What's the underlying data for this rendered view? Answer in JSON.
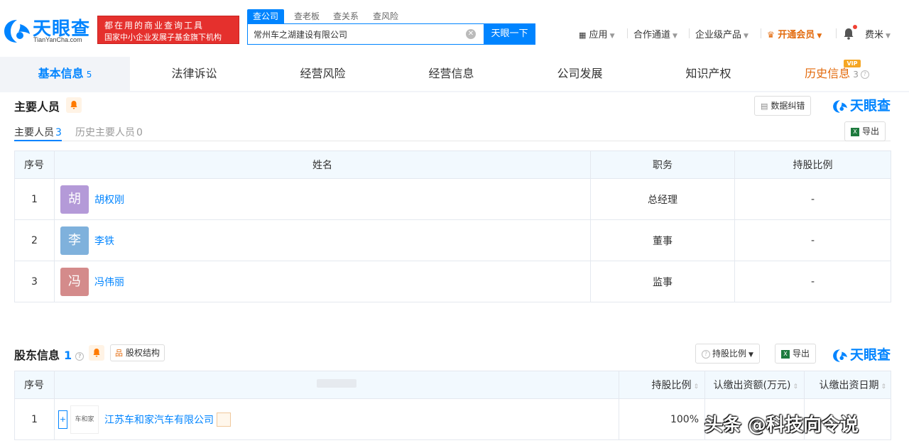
{
  "header": {
    "logo_cn": "天眼查",
    "logo_en": "TianYanCha.com",
    "slogan_line1": "都在用的商业查询工具",
    "slogan_line2": "国家中小企业发展子基金旗下机构",
    "search_tabs": [
      "查公司",
      "查老板",
      "查关系",
      "查风险"
    ],
    "search_value": "常州车之湖建设有限公司",
    "search_button": "天眼一下",
    "nav": {
      "apps": "应用",
      "partner": "合作通道",
      "enterprise": "企业级产品",
      "vip": "开通会员",
      "user": "费米"
    }
  },
  "category_tabs": [
    {
      "label": "基本信息",
      "count": "5"
    },
    {
      "label": "法律诉讼",
      "count": ""
    },
    {
      "label": "经营风险",
      "count": ""
    },
    {
      "label": "经营信息",
      "count": ""
    },
    {
      "label": "公司发展",
      "count": ""
    },
    {
      "label": "知识产权",
      "count": ""
    },
    {
      "label": "历史信息",
      "count": "3"
    }
  ],
  "vip_badge": "VIP",
  "personnel": {
    "title": "主要人员",
    "correct_button": "数据纠错",
    "brand": "天眼查",
    "export_button": "导出",
    "sub_tabs": [
      {
        "label": "主要人员",
        "count": "3"
      },
      {
        "label": "历史主要人员",
        "count": "0"
      }
    ],
    "columns": [
      "序号",
      "姓名",
      "职务",
      "持股比例"
    ],
    "rows": [
      {
        "no": "1",
        "avatar": "胡",
        "name": "胡权刚",
        "title": "总经理",
        "ratio": "-",
        "color": "#b49ad8"
      },
      {
        "no": "2",
        "avatar": "李",
        "name": "李铁",
        "title": "董事",
        "ratio": "-",
        "color": "#7fb1dc"
      },
      {
        "no": "3",
        "avatar": "冯",
        "name": "冯伟丽",
        "title": "监事",
        "ratio": "-",
        "color": "#d48b8b"
      }
    ]
  },
  "shareholders": {
    "title": "股东信息",
    "count": "1",
    "structure_button": "股权结构",
    "ratio_dropdown": "持股比例",
    "export_button": "导出",
    "brand": "天眼查",
    "columns": [
      "序号",
      "持股比例",
      "认缴出资额(万元)",
      "认缴出资日期"
    ],
    "rows": [
      {
        "no": "1",
        "logo": "车和家",
        "name": "江苏车和家汽车有限公司",
        "ratio": "100%"
      }
    ]
  },
  "watermark": "头条 @科技向令说"
}
